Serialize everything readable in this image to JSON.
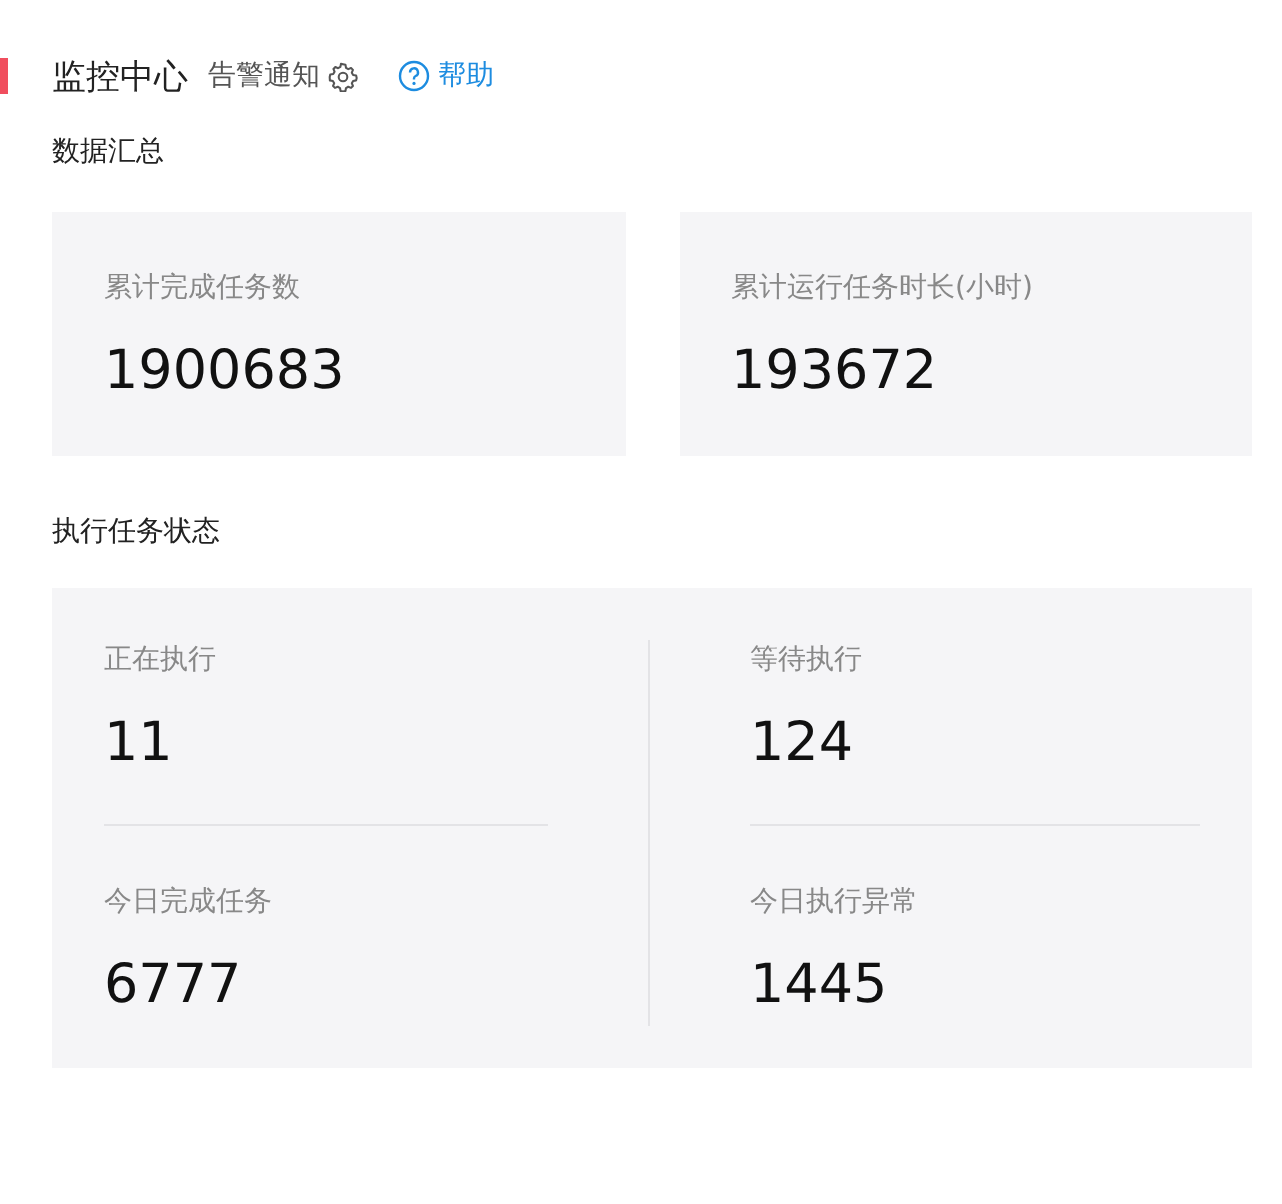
{
  "header": {
    "title": "监控中心",
    "alert_link": "告警通知",
    "help_link": "帮助"
  },
  "summary": {
    "title": "数据汇总",
    "cards": [
      {
        "label": "累计完成任务数",
        "value": "1900683"
      },
      {
        "label": "累计运行任务时长(小时)",
        "value": "193672"
      }
    ]
  },
  "status": {
    "title": "执行任务状态",
    "items": [
      {
        "label": "正在执行",
        "value": "11"
      },
      {
        "label": "等待执行",
        "value": "124"
      },
      {
        "label": "今日完成任务",
        "value": "6777"
      },
      {
        "label": "今日执行异常",
        "value": "1445"
      }
    ]
  }
}
